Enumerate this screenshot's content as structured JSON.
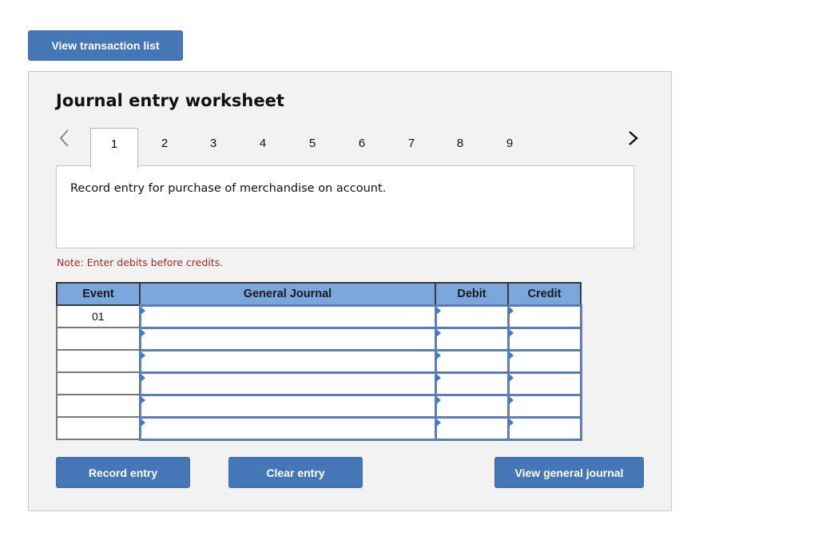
{
  "top_button": {
    "label": "View transaction list"
  },
  "worksheet": {
    "title": "Journal entry worksheet",
    "nav": {
      "prev_icon": "chevron-left-icon",
      "next_icon": "chevron-right-icon"
    },
    "tabs": [
      {
        "label": "1",
        "active": true
      },
      {
        "label": "2"
      },
      {
        "label": "3"
      },
      {
        "label": "4"
      },
      {
        "label": "5"
      },
      {
        "label": "6"
      },
      {
        "label": "7"
      },
      {
        "label": "8"
      },
      {
        "label": "9"
      }
    ],
    "description": "Record entry for purchase of merchandise on account.",
    "note": "Note: Enter debits before credits.",
    "table": {
      "headers": {
        "event": "Event",
        "journal": "General Journal",
        "debit": "Debit",
        "credit": "Credit"
      },
      "rows": [
        {
          "event": "01",
          "journal": "",
          "debit": "",
          "credit": ""
        },
        {
          "event": "",
          "journal": "",
          "debit": "",
          "credit": ""
        },
        {
          "event": "",
          "journal": "",
          "debit": "",
          "credit": ""
        },
        {
          "event": "",
          "journal": "",
          "debit": "",
          "credit": ""
        },
        {
          "event": "",
          "journal": "",
          "debit": "",
          "credit": ""
        },
        {
          "event": "",
          "journal": "",
          "debit": "",
          "credit": ""
        }
      ]
    },
    "buttons": {
      "record": "Record entry",
      "clear": "Clear entry",
      "view_journal": "View general journal"
    }
  },
  "colors": {
    "button_blue": "#4576b5",
    "header_blue": "#7aa6dc",
    "note_red": "#a52a2a",
    "panel_bg": "#f2f2f2"
  }
}
